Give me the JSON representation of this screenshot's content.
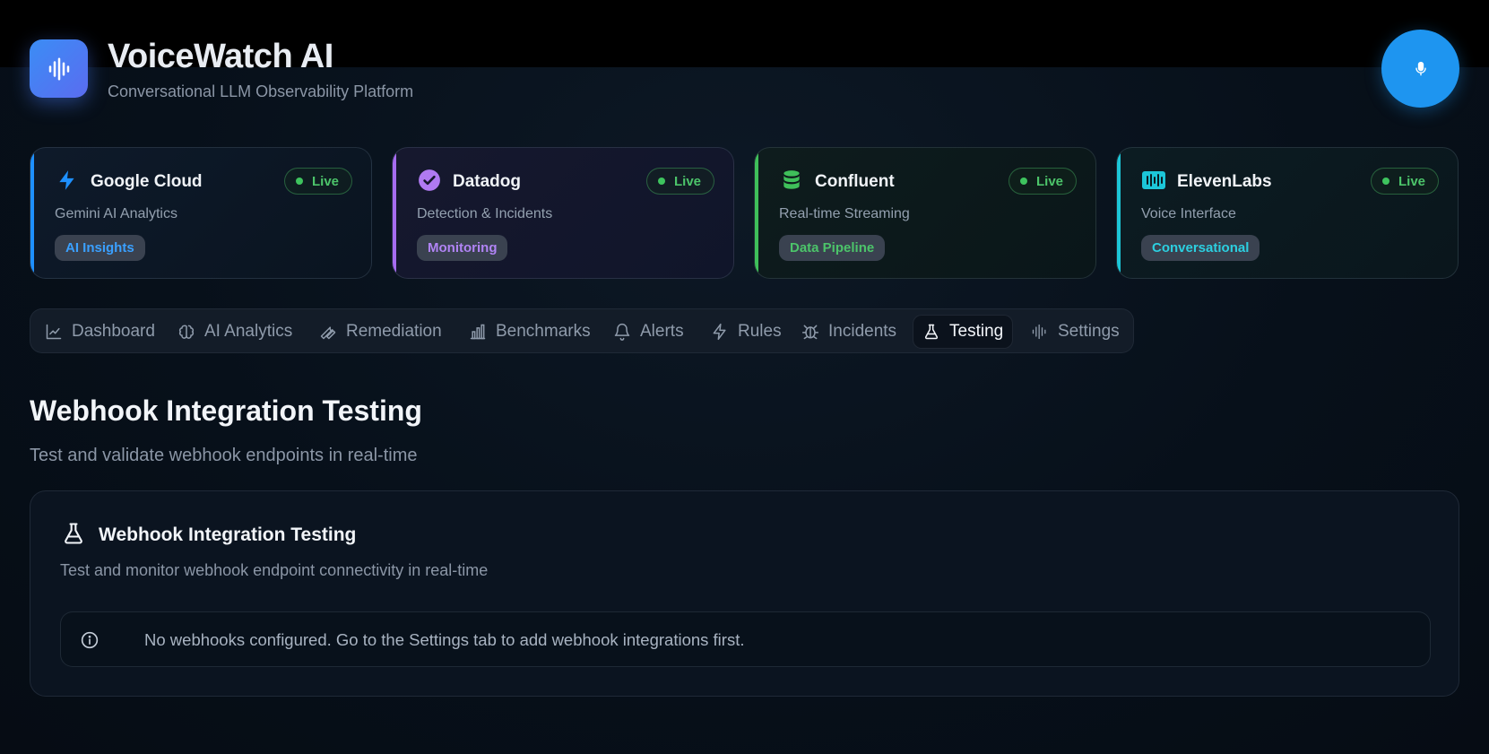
{
  "header": {
    "title": "VoiceWatch AI",
    "subtitle": "Conversational LLM Observability Platform",
    "logo_icon": "audio-waveform-icon",
    "mic_icon": "microphone-icon"
  },
  "integrations": [
    {
      "name": "Google Cloud",
      "desc": "Gemini AI Analytics",
      "tag": "AI Insights",
      "status": "Live",
      "icon": "lightning-icon",
      "accent": "#1e90ff",
      "tag_color": "#3aa0ff"
    },
    {
      "name": "Datadog",
      "desc": "Detection & Incidents",
      "tag": "Monitoring",
      "status": "Live",
      "icon": "check-circle-icon",
      "accent": "#a66cf0",
      "tag_color": "#b184f5"
    },
    {
      "name": "Confluent",
      "desc": "Real-time Streaming",
      "tag": "Data Pipeline",
      "status": "Live",
      "icon": "database-icon",
      "accent": "#3fbf5a",
      "tag_color": "#4cc46a"
    },
    {
      "name": "ElevenLabs",
      "desc": "Voice Interface",
      "tag": "Conversational",
      "status": "Live",
      "icon": "audio-lines-icon",
      "accent": "#1cc6d8",
      "tag_color": "#2ccfe0"
    }
  ],
  "tabs": [
    {
      "label": "Dashboard",
      "icon": "line-chart-icon"
    },
    {
      "label": "AI Analytics",
      "icon": "brain-icon"
    },
    {
      "label": "Remediation",
      "icon": "wrench-icon"
    },
    {
      "label": "Benchmarks",
      "icon": "bar-chart-icon"
    },
    {
      "label": "Alerts",
      "icon": "bell-icon"
    },
    {
      "label": "Rules",
      "icon": "lightning-icon"
    },
    {
      "label": "Incidents",
      "icon": "bug-icon"
    },
    {
      "label": "Testing",
      "icon": "flask-icon"
    },
    {
      "label": "Settings",
      "icon": "audio-waveform-icon"
    }
  ],
  "active_tab": "Testing",
  "main": {
    "title": "Webhook Integration Testing",
    "subtitle": "Test and validate webhook endpoints in real-time",
    "panel": {
      "title": "Webhook Integration Testing",
      "subtitle": "Test and monitor webhook endpoint connectivity in real-time",
      "icon": "flask-icon",
      "notice_icon": "info-icon",
      "notice": "No webhooks configured. Go to the Settings tab to add webhook integrations first."
    }
  }
}
